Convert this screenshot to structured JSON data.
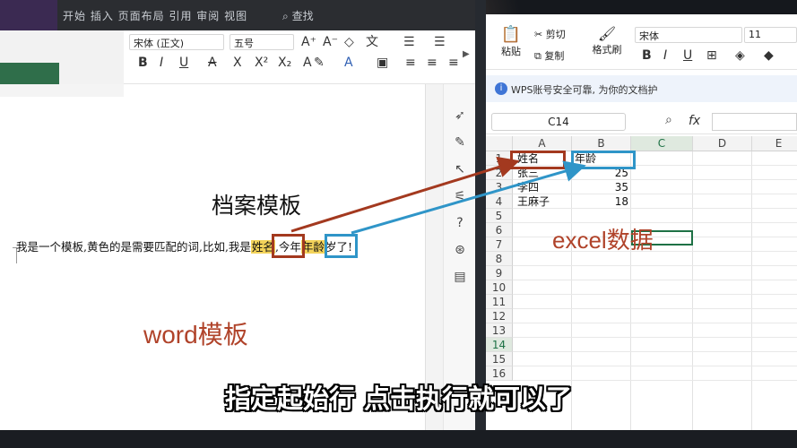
{
  "word": {
    "menu_text": "开始 插入 页面布局 引用 审阅 视图",
    "search_label": "查找",
    "font_name": "宋体 (正文)",
    "font_size": "五号",
    "doc_title": "档案模板",
    "line_before": "我是一个模板,黄色的是需要匹配的词,比如,我是",
    "hl_name": "姓名",
    "line_middle": ",今年",
    "hl_age": "年龄",
    "line_after": "岁了!",
    "annotation_label": "word模板"
  },
  "excel": {
    "paste_label": "粘贴",
    "cut_label": "剪切",
    "copy_label": "复制",
    "format_painter_label": "格式刷",
    "font_name": "宋体",
    "font_size": "11",
    "notice": "WPS账号安全可靠, 为你的文档护",
    "cell_ref": "C14",
    "fx_label": "fx",
    "columns": [
      "A",
      "B",
      "C",
      "D",
      "E"
    ],
    "rows": [
      "1",
      "2",
      "3",
      "4",
      "5",
      "6",
      "7",
      "8",
      "9",
      "10",
      "11",
      "12",
      "13",
      "14",
      "15",
      "16"
    ],
    "table": [
      {
        "a": "姓名",
        "b": "年龄"
      },
      {
        "a": "张三",
        "b": "25"
      },
      {
        "a": "李四",
        "b": "35"
      },
      {
        "a": "王麻子",
        "b": "18"
      }
    ],
    "annotation_label": "excel数据"
  },
  "subtitle": "指定起始行 点击执行就可以了",
  "colors": {
    "annotation_red": "#a3391f",
    "annotation_blue": "#2f95c8",
    "highlight": "#f3d35a",
    "excel_green": "#1e7145"
  }
}
